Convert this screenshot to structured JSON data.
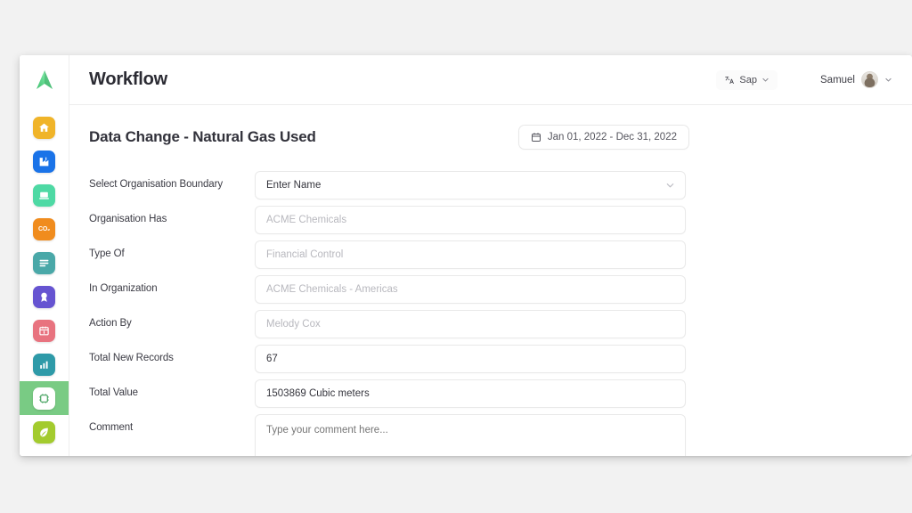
{
  "app": {
    "title": "Workflow",
    "logo_icon": "green-triangle-logo"
  },
  "topbar": {
    "language": {
      "label": "Sap",
      "icon": "translate-icon",
      "chevron_icon": "chevron-down-icon"
    },
    "user": {
      "name": "Samuel",
      "avatar_icon": "user-avatar",
      "chevron_icon": "chevron-down-icon"
    }
  },
  "sidebar": {
    "items": [
      {
        "name": "home",
        "icon": "home-icon",
        "color": "#f0b429",
        "active": false
      },
      {
        "name": "facility",
        "icon": "factory-icon",
        "color": "#1a73e8",
        "active": false
      },
      {
        "name": "reports",
        "icon": "laptop-icon",
        "color": "#4ed9a4",
        "active": false
      },
      {
        "name": "emissions",
        "icon": "co2-icon",
        "color": "#f08c1e",
        "active": false,
        "text": "CO₂"
      },
      {
        "name": "data-entry",
        "icon": "form-icon",
        "color": "#4aa8a8",
        "active": false
      },
      {
        "name": "targets",
        "icon": "badge-icon",
        "color": "#6654d1",
        "active": false
      },
      {
        "name": "calendar",
        "icon": "calendar-icon",
        "color": "#e8737f",
        "active": false
      },
      {
        "name": "analytics",
        "icon": "chart-icon",
        "color": "#2e9aa8",
        "active": false
      },
      {
        "name": "workflow",
        "icon": "workflow-icon",
        "color": "#79cb84",
        "active": true
      },
      {
        "name": "sustainability",
        "icon": "leaf-icon",
        "color": "#a3cb2e",
        "active": false
      }
    ]
  },
  "page": {
    "title": "Data Change - Natural Gas Used",
    "date_range": {
      "text": "Jan 01, 2022 - Dec 31, 2022",
      "icon": "calendar-icon"
    }
  },
  "form": {
    "fields": [
      {
        "label": "Select Organisation Boundary",
        "type": "select",
        "value": "Enter Name",
        "is_placeholder": false,
        "chevron_icon": "chevron-down-icon"
      },
      {
        "label": "Organisation Has",
        "type": "text",
        "value": "ACME Chemicals",
        "is_placeholder": true
      },
      {
        "label": "Type Of",
        "type": "text",
        "value": "Financial Control",
        "is_placeholder": true
      },
      {
        "label": "In Organization",
        "type": "text",
        "value": "ACME Chemicals - Americas",
        "is_placeholder": true
      },
      {
        "label": "Action By",
        "type": "text",
        "value": "Melody Cox",
        "is_placeholder": true
      },
      {
        "label": "Total New Records",
        "type": "text",
        "value": "67",
        "is_placeholder": false
      },
      {
        "label": "Total Value",
        "type": "text",
        "value": "1503869 Cubic meters",
        "is_placeholder": false
      },
      {
        "label": "Comment",
        "type": "textarea",
        "value": "Type your comment here...",
        "is_placeholder": true
      }
    ]
  },
  "colors": {
    "accent_green": "#79cb84",
    "page_background": "#f2f2f2",
    "card_background": "#ffffff",
    "border": "#e9e9e9",
    "text_primary": "#32323b",
    "text_placeholder": "#b8b8be"
  }
}
